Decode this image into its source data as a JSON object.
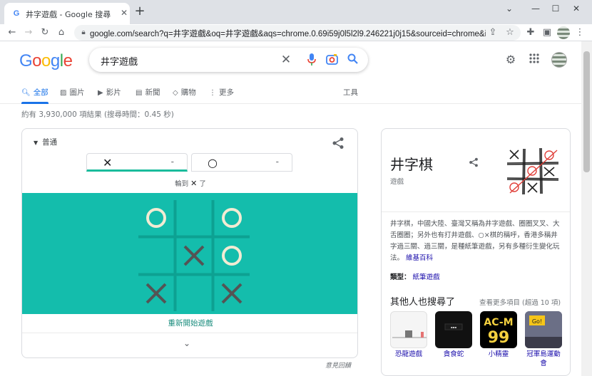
{
  "browser": {
    "tab_title": "井字遊戲 - Google 搜尋",
    "tab_favicon": "G",
    "url": "google.com/search?q=井字遊戲&oq=井字遊戲&aqs=chrome.0.69i59j0l5l2l9.246221j0j15&sourceid=chrome&ie=..."
  },
  "search": {
    "query": "井字遊戲"
  },
  "nav": {
    "tabs": [
      {
        "label": "全部",
        "icon": "search-icon"
      },
      {
        "label": "圖片",
        "icon": "image-icon"
      },
      {
        "label": "影片",
        "icon": "play-icon"
      },
      {
        "label": "新聞",
        "icon": "news-icon"
      },
      {
        "label": "購物",
        "icon": "tag-icon"
      },
      {
        "label": "更多",
        "icon": "more-vert-icon"
      }
    ],
    "tools": "工具"
  },
  "result_stats": "約有 3,930,000 項結果 (搜尋時間：0.45 秒)",
  "game": {
    "difficulty": "普通",
    "score_x_symbol": "✕",
    "score_x_value": "-",
    "score_o_symbol": "○",
    "score_o_value": "-",
    "turn_prefix": "輪到",
    "turn_symbol": "✕",
    "turn_suffix": "了",
    "board": [
      [
        "O",
        "",
        "O"
      ],
      [
        "",
        "X",
        "O"
      ],
      [
        "X",
        "",
        "X"
      ]
    ],
    "restart": "重新開始遊戲",
    "feedback": "意見回饋"
  },
  "knowledge_panel": {
    "title": "井字棋",
    "subtitle": "遊戲",
    "description": "井字棋，中國大陸、臺灣又稱為井字遊戲、圈圈叉叉、大舌圈圈；另外也有打井遊戲、○×棋的稱呼，香港多稱井字過三關、過三關，是種紙筆遊戲，另有多種衍生變化玩法。",
    "source_link": "維基百科",
    "type_label": "類型：",
    "type_value": "紙筆遊戲",
    "others_title": "其他人也搜尋了",
    "others_more": "查看更多項目 (超過 10 項)",
    "others": [
      {
        "label": "恐龍遊戲"
      },
      {
        "label": "貪食蛇"
      },
      {
        "label": "小精靈"
      },
      {
        "label": "冠軍島運動會"
      }
    ]
  },
  "colors": {
    "board": "#14bdac",
    "board_lines": "#0da192",
    "x_mark": "#545454",
    "o_mark": "#f2ebd3",
    "accent": "#1a73e8"
  }
}
